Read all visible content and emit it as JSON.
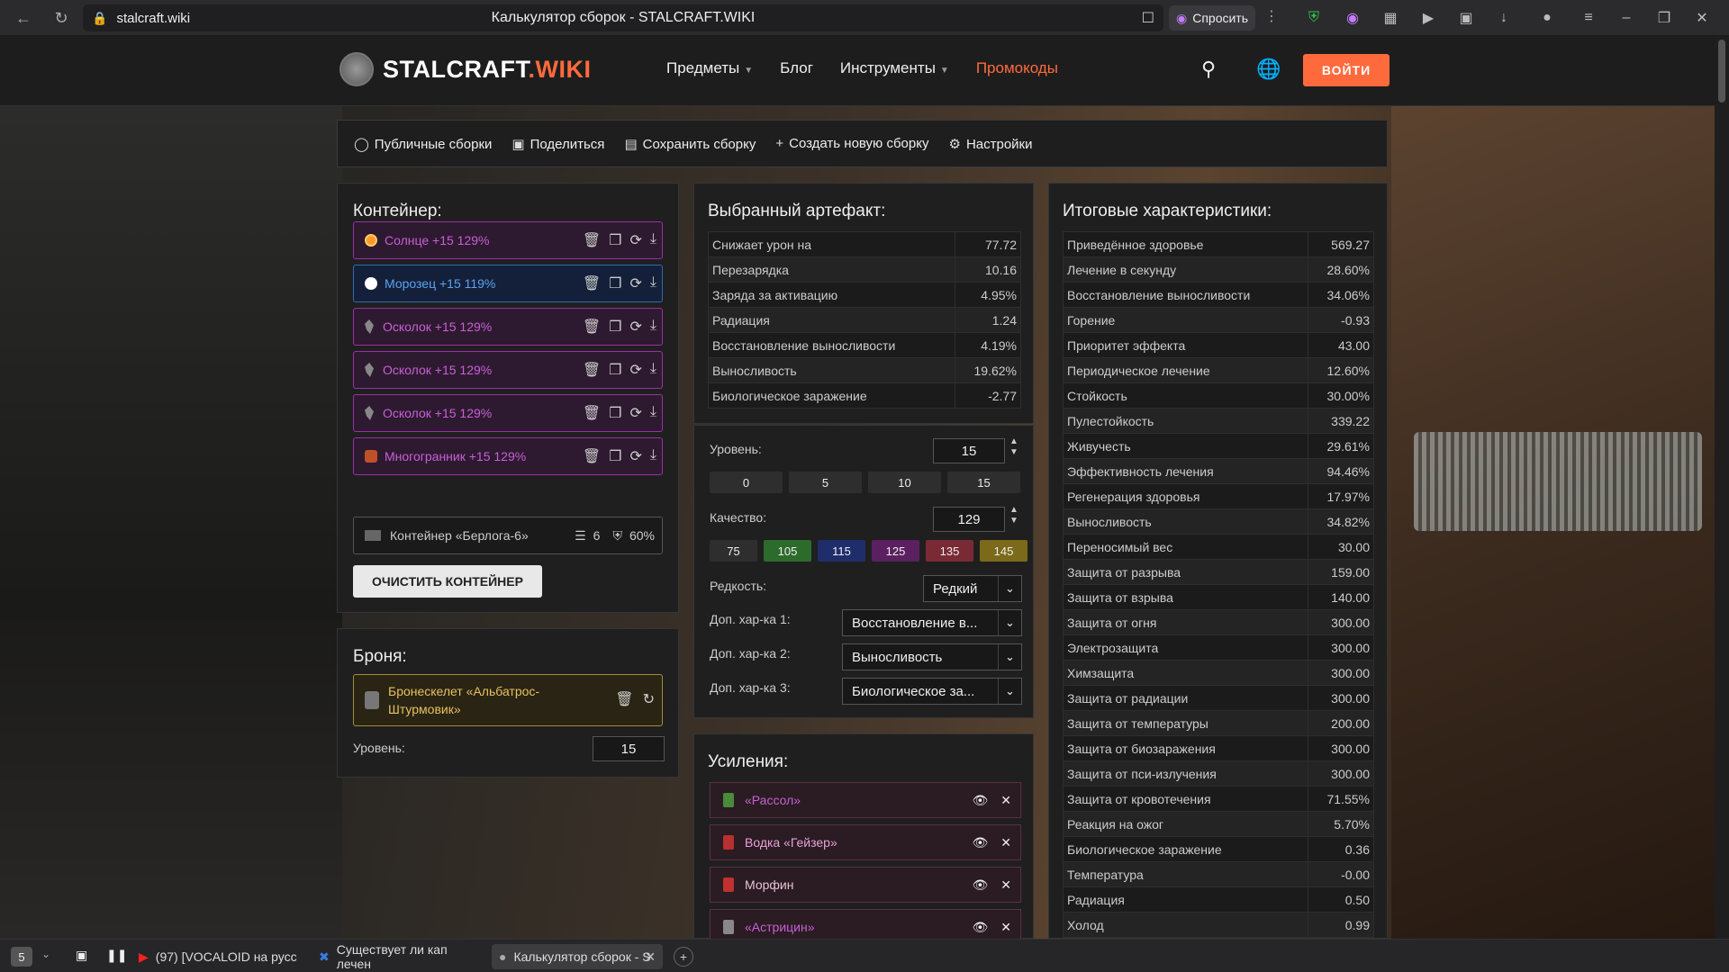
{
  "browser": {
    "url": "stalcraft.wiki",
    "page_title": "Калькулятор сборок - STALCRAFT.WIKI",
    "ask_label": "Спросить"
  },
  "nav": {
    "logo_main": "STALCRAFT",
    "logo_suffix": ".WIKI",
    "items": [
      "Предметы",
      "Блог",
      "Инструменты",
      "Промокоды"
    ],
    "login": "ВОЙТИ"
  },
  "toolbar": {
    "public": "Публичные сборки",
    "share": "Поделиться",
    "save": "Сохранить сборку",
    "new": "Создать новую сборку",
    "settings": "Настройки"
  },
  "container": {
    "title": "Контейнер:",
    "slots": [
      {
        "name": "Солнце +15 129%",
        "style": "purple",
        "icon": "sun"
      },
      {
        "name": "Морозец +15 119%",
        "style": "blue",
        "icon": "frost"
      },
      {
        "name": "Осколок +15 129%",
        "style": "purple",
        "icon": "shard"
      },
      {
        "name": "Осколок +15 129%",
        "style": "purple",
        "icon": "shard"
      },
      {
        "name": "Осколок +15 129%",
        "style": "purple",
        "icon": "shard"
      },
      {
        "name": "Многогранник +15 129%",
        "style": "purple",
        "icon": "polyhedron"
      }
    ],
    "box_name": "Контейнер «Берлога-6»",
    "box_slots": "6",
    "box_protection": "60%",
    "clear_button": "ОЧИСТИТЬ КОНТЕЙНЕР"
  },
  "armor": {
    "title": "Броня:",
    "name_line1": "Бронескелет «Альбатрос-",
    "name_line2": "Штурмовик»",
    "level_label": "Уровень:",
    "level": "15"
  },
  "artifact": {
    "title": "Выбранный артефакт:",
    "stats": [
      {
        "label": "Снижает урон на",
        "value": "77.72",
        "color": "white"
      },
      {
        "label": "Перезарядка",
        "value": "10.16",
        "color": "white"
      },
      {
        "label": "Заряда за активацию",
        "value": "4.95%",
        "color": "white"
      },
      {
        "label": "Радиация",
        "value": "1.24",
        "color": "red"
      },
      {
        "label": "Восстановление выносливости",
        "value": "4.19%",
        "color": "green"
      },
      {
        "label": "Выносливость",
        "value": "19.62%",
        "color": "green"
      },
      {
        "label": "Биологическое заражение",
        "value": "-2.77",
        "color": "green"
      }
    ],
    "level_label": "Уровень:",
    "level": "15",
    "level_presets": [
      "0",
      "5",
      "10",
      "15"
    ],
    "quality_label": "Качество:",
    "quality": "129",
    "quality_presets": [
      {
        "v": "75",
        "bg": "#2e2e2e"
      },
      {
        "v": "105",
        "bg": "#2d6b2d"
      },
      {
        "v": "115",
        "bg": "#1f2e6b"
      },
      {
        "v": "125",
        "bg": "#5a2060"
      },
      {
        "v": "135",
        "bg": "#7a2a35"
      },
      {
        "v": "145",
        "bg": "#7a6a1a"
      }
    ],
    "rarity_label": "Редкость:",
    "rarity": "Редкий",
    "extra1_label": "Доп. хар-ка 1:",
    "extra1": "Восстановление в...",
    "extra2_label": "Доп. хар-ка 2:",
    "extra2": "Выносливость",
    "extra3_label": "Доп. хар-ка 3:",
    "extra3": "Биологическое за..."
  },
  "boosts": {
    "title": "Усиления:",
    "items": [
      {
        "name": "«Рассол»",
        "color": "#c85fd6",
        "icon_color": "#4a8a3a"
      },
      {
        "name": "Водка «Гейзер»",
        "color": "#e8a0d8",
        "icon_color": "#b83030"
      },
      {
        "name": "Морфин",
        "color": "#e8c0d8",
        "icon_color": "#c03030"
      },
      {
        "name": "«Астрицин»",
        "color": "#c85fd6",
        "icon_color": "#888888"
      }
    ]
  },
  "totals": {
    "title": "Итоговые характеристики:",
    "stats": [
      {
        "label": "Приведённое здоровье",
        "value": "569.27",
        "color": "yellow"
      },
      {
        "label": "Лечение в секунду",
        "value": "28.60%",
        "color": "yellow"
      },
      {
        "label": "Восстановление выносливости",
        "value": "34.06%",
        "color": "green"
      },
      {
        "label": "Горение",
        "value": "-0.93",
        "color": "green"
      },
      {
        "label": "Приоритет эффекта",
        "value": "43.00",
        "color": "green"
      },
      {
        "label": "Периодическое лечение",
        "value": "12.60%",
        "color": "green"
      },
      {
        "label": "Стойкость",
        "value": "30.00%",
        "color": "green"
      },
      {
        "label": "Пулестойкость",
        "value": "339.22",
        "color": "green"
      },
      {
        "label": "Живучесть",
        "value": "29.61%",
        "color": "green"
      },
      {
        "label": "Эффективность лечения",
        "value": "94.46%",
        "color": "green"
      },
      {
        "label": "Регенерация здоровья",
        "value": "17.97%",
        "color": "green"
      },
      {
        "label": "Выносливость",
        "value": "34.82%",
        "color": "green"
      },
      {
        "label": "Переносимый вес",
        "value": "30.00",
        "color": "green"
      },
      {
        "label": "Защита от разрыва",
        "value": "159.00",
        "color": "green"
      },
      {
        "label": "Защита от взрыва",
        "value": "140.00",
        "color": "green"
      },
      {
        "label": "Защита от огня",
        "value": "300.00",
        "color": "green"
      },
      {
        "label": "Электрозащита",
        "value": "300.00",
        "color": "green"
      },
      {
        "label": "Химзащита",
        "value": "300.00",
        "color": "green"
      },
      {
        "label": "Защита от радиации",
        "value": "300.00",
        "color": "green"
      },
      {
        "label": "Защита от температуры",
        "value": "200.00",
        "color": "green"
      },
      {
        "label": "Защита от биозаражения",
        "value": "300.00",
        "color": "green"
      },
      {
        "label": "Защита от пси-излучения",
        "value": "300.00",
        "color": "green"
      },
      {
        "label": "Защита от кровотечения",
        "value": "71.55%",
        "color": "green"
      },
      {
        "label": "Реакция на ожог",
        "value": "5.70%",
        "color": "green"
      },
      {
        "label": "Биологическое заражение",
        "value": "0.36",
        "color": "red"
      },
      {
        "label": "Температура",
        "value": "-0.00",
        "color": "green"
      },
      {
        "label": "Радиация",
        "value": "0.50",
        "color": "red"
      },
      {
        "label": "Холод",
        "value": "0.99",
        "color": "red"
      }
    ]
  },
  "taskbar": {
    "workspace": "5",
    "tabs": [
      "(97) [VOCALOID на русс",
      "Существует ли кап лечен",
      "Калькулятор сборок - S"
    ]
  }
}
